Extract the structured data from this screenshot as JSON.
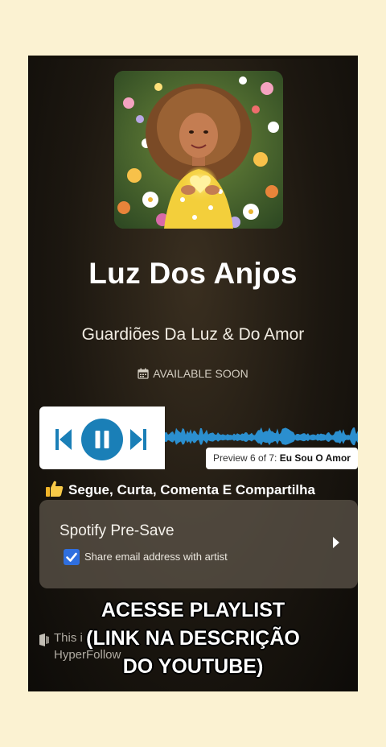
{
  "release": {
    "title": "Luz Dos Anjos",
    "artist": "Guardiões Da Luz & Do Amor",
    "availability": "AVAILABLE SOON"
  },
  "player": {
    "preview_prefix": "Preview 6 of 7:",
    "track_name": "Eu Sou O Amor",
    "accent_color": "#1a7fb7",
    "wave_color": "#2b8fcf"
  },
  "cta": {
    "text": "Segue, Curta, Comenta E Compartilha"
  },
  "presave": {
    "title": "Spotify Pre-Save",
    "checkbox_label": "Share email address with artist",
    "checked": true
  },
  "footer": {
    "line1": "This i",
    "line2": "HyperFollow"
  },
  "overlay": {
    "line1": "ACESSE PLAYLIST",
    "line2": "(LINK NA DESCRIÇÃO",
    "line3": "DO YOUTUBE)"
  },
  "colors": {
    "background": "#fbf2d2",
    "checkbox": "#2f6fdf"
  }
}
